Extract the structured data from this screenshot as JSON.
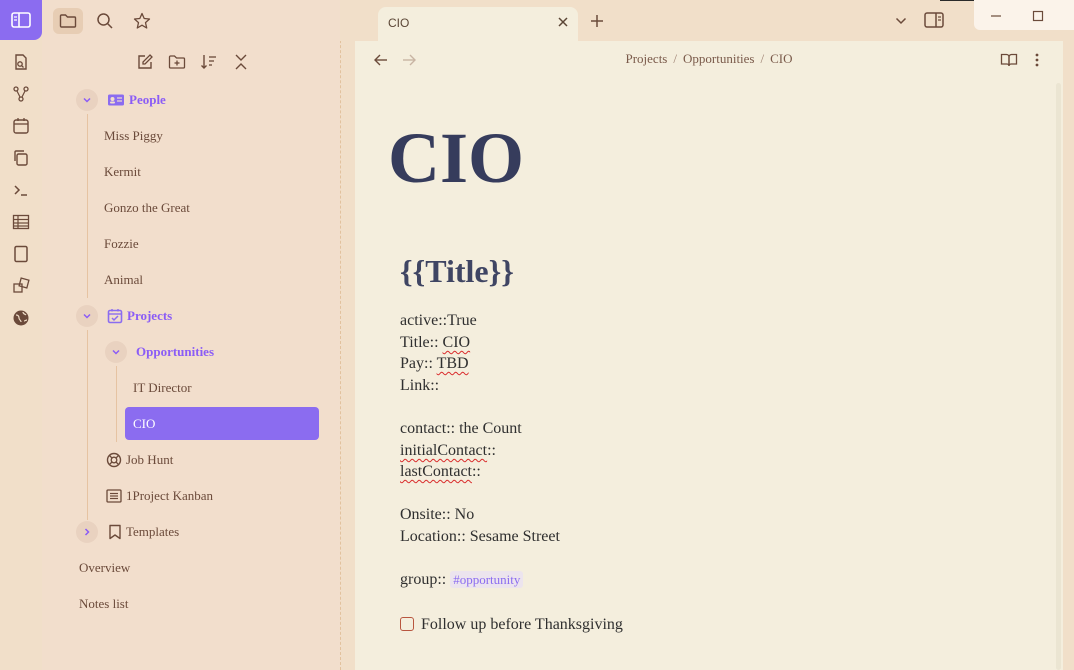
{
  "ribbon": {
    "icons": [
      "sidebar-toggle-icon",
      "open-quick-switcher-icon",
      "graph-view-icon",
      "daily-note-calendar-icon",
      "templates-copy-icon",
      "command-palette-icon",
      "table-icon",
      "canvas-book-icon",
      "random-note-icon",
      "publish-globe-icon"
    ]
  },
  "sidebar": {
    "top_icons": [
      "folder-icon",
      "search-icon",
      "bookmark-star-icon"
    ],
    "toolbar": [
      "new-note-icon",
      "new-folder-icon",
      "sort-icon",
      "collapse-all-icon"
    ],
    "tree": {
      "people": "People",
      "people_items": [
        "Miss Piggy",
        "Kermit",
        "Gonzo the Great",
        "Fozzie",
        "Animal"
      ],
      "projects": "Projects",
      "opportunities": "Opportunities",
      "opportunity_items": [
        "IT Director",
        "CIO"
      ],
      "job_hunt": "Job Hunt",
      "kanban": "1Project Kanban",
      "templates": "Templates",
      "overview": "Overview",
      "notes_list": "Notes list"
    }
  },
  "tab": {
    "label": "CIO"
  },
  "breadcrumb": {
    "parts": [
      "Projects",
      "Opportunities",
      "CIO"
    ],
    "sep": "/"
  },
  "note": {
    "title": "CIO",
    "heading": "{{Title}}",
    "active": "active::True",
    "title_key": "Title:: ",
    "title_val": "CIO",
    "pay_key": "Pay:: ",
    "pay_val": "TBD",
    "link": "Link::",
    "contact": "contact:: the Count",
    "initial_contact_key": "initialContact",
    "initial_contact_rest": "::",
    "last_contact_key": "lastContact",
    "last_contact_rest": "::",
    "onsite": "Onsite:: No",
    "location": "Location:: Sesame Street",
    "group_key": "group:: ",
    "group_tag": "#opportunity",
    "task": "Follow up before Thanksgiving"
  },
  "colors": {
    "accent": "#8b6cf0",
    "title": "#363c5c",
    "task_border": "#b8563f"
  }
}
